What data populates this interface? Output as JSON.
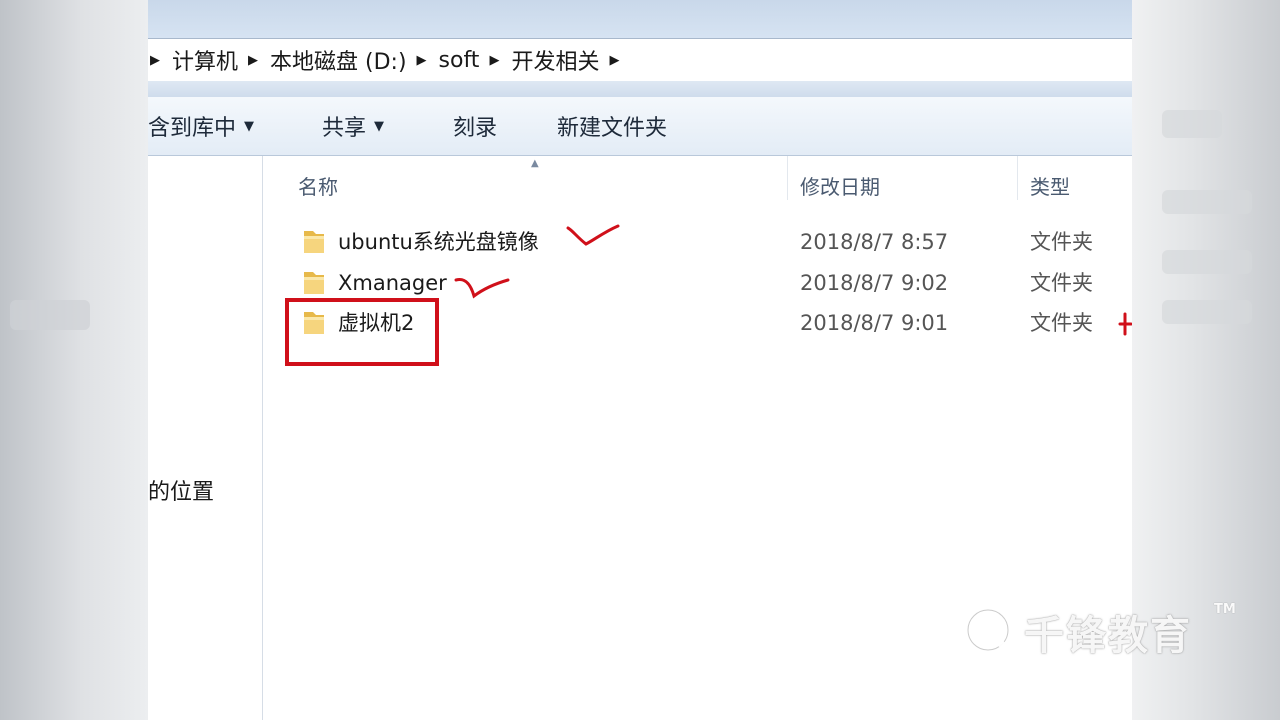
{
  "breadcrumb": {
    "items": [
      "计算机",
      "本地磁盘 (D:)",
      "soft",
      "开发相关"
    ]
  },
  "toolbar": {
    "include_library": "含到库中",
    "share": "共享",
    "burn": "刻录",
    "new_folder": "新建文件夹"
  },
  "nav": {
    "location_label": "的位置"
  },
  "columns": {
    "name": "名称",
    "date": "修改日期",
    "type": "类型"
  },
  "files": [
    {
      "name": "ubuntu系统光盘镜像",
      "date": "2018/8/7 8:57",
      "type": "文件夹",
      "icon": "folder-icon"
    },
    {
      "name": "Xmanager",
      "date": "2018/8/7 9:02",
      "type": "文件夹",
      "icon": "folder-icon"
    },
    {
      "name": "虚拟机2",
      "date": "2018/8/7 9:01",
      "type": "文件夹",
      "icon": "folder-icon"
    }
  ],
  "annotations": {
    "ink_color": "#d0101a"
  },
  "watermark": {
    "text": "千锋教育",
    "tm": "TM"
  }
}
